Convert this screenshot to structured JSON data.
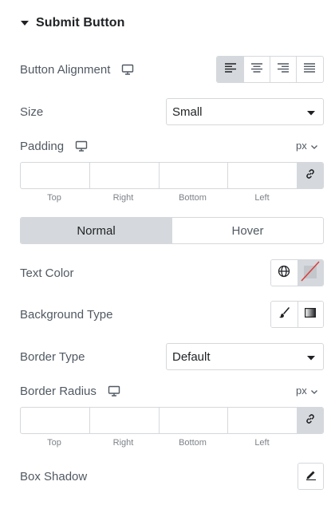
{
  "section": {
    "title": "Submit Button",
    "caret_icon": "caret-down-icon"
  },
  "button_alignment": {
    "label": "Button Alignment",
    "device_icon": "desktop-icon",
    "options": [
      "align-left-icon",
      "align-center-icon",
      "align-right-icon",
      "align-justify-icon"
    ],
    "active_index": 0
  },
  "size": {
    "label": "Size",
    "value": "Small"
  },
  "padding": {
    "label": "Padding",
    "device_icon": "desktop-icon",
    "unit": "px",
    "sides": [
      "Top",
      "Right",
      "Bottom",
      "Left"
    ],
    "linked": true
  },
  "state_tabs": {
    "normal": "Normal",
    "hover": "Hover",
    "active": "Normal"
  },
  "text_color": {
    "label": "Text Color",
    "globe_icon": "globe-icon",
    "swatch": "none"
  },
  "background_type": {
    "label": "Background Type",
    "options": [
      "brush-icon",
      "gradient-icon"
    ]
  },
  "border_type": {
    "label": "Border Type",
    "value": "Default"
  },
  "border_radius": {
    "label": "Border Radius",
    "device_icon": "desktop-icon",
    "unit": "px",
    "sides": [
      "Top",
      "Right",
      "Bottom",
      "Left"
    ],
    "linked": true
  },
  "box_shadow": {
    "label": "Box Shadow",
    "edit_icon": "pencil-icon"
  },
  "colors": {
    "border": "#d5d8dc",
    "active_bg": "#d5d8dc",
    "text": "#515962",
    "heading": "#1f2124",
    "swatch_slash": "#d93d3d"
  }
}
